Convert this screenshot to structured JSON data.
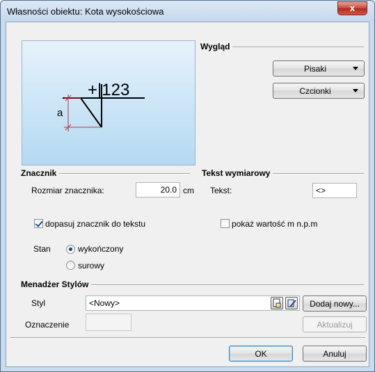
{
  "window": {
    "title": "Własności obiektu: Kota wysokościowa",
    "close_glyph": "x"
  },
  "preview": {
    "dimension_text": "+|123",
    "marker_label": "a"
  },
  "wyglad": {
    "title": "Wygląd",
    "pens_label": "Pisaki",
    "fonts_label": "Czcionki"
  },
  "znacznik": {
    "title": "Znacznik",
    "size_label": "Rozmiar znacznika:",
    "size_value": "20.0",
    "size_unit": "cm",
    "fit_label": "dopasuj znacznik do tekstu",
    "state_label": "Stan",
    "state_options": [
      "wykończony",
      "surowy"
    ],
    "state_selected": "wykończony"
  },
  "tekst": {
    "title": "Tekst wymiarowy",
    "text_label": "Tekst:",
    "text_value": "<>",
    "show_label": "pokaż wartość m n.p.m"
  },
  "styles": {
    "title": "Menadżer Stylów",
    "style_label": "Styl",
    "style_value": "<Nowy>",
    "add_label": "Dodaj nowy...",
    "mark_label": "Oznaczenie",
    "mark_value": "",
    "update_label": "Aktualizuj"
  },
  "footer": {
    "ok_label": "OK",
    "cancel_label": "Anuluj"
  },
  "colors": {
    "marker_red": "#c0303a",
    "preview_bg": "#b4d9f2"
  }
}
